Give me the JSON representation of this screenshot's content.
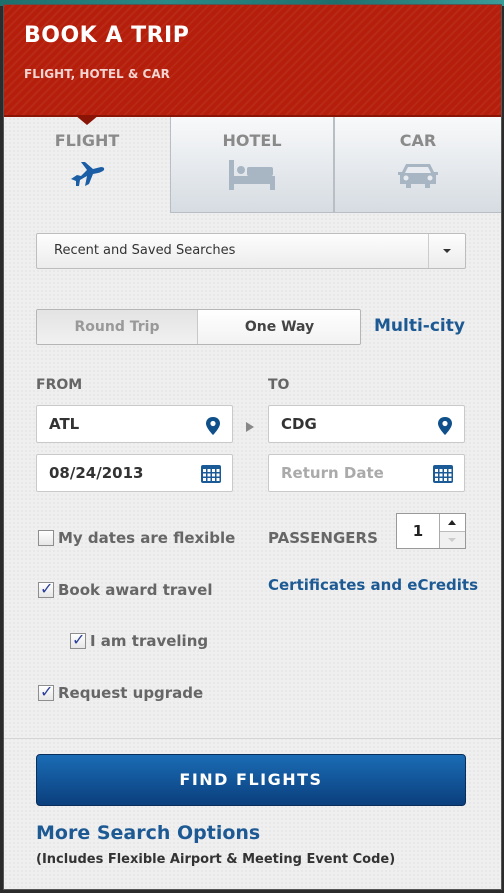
{
  "header": {
    "title": "BOOK A TRIP",
    "subtitle": "FLIGHT, HOTEL & CAR"
  },
  "tabs": [
    {
      "label": "FLIGHT",
      "icon": "airplane-icon",
      "active": true
    },
    {
      "label": "HOTEL",
      "icon": "bed-icon",
      "active": false
    },
    {
      "label": "CAR",
      "icon": "car-icon",
      "active": false
    }
  ],
  "recent_searches": {
    "label": "Recent and Saved Searches"
  },
  "trip_type": {
    "options": [
      "Round Trip",
      "One Way"
    ],
    "selected": "Round Trip",
    "multi_city_label": "Multi-city"
  },
  "from": {
    "label": "FROM",
    "airport": "ATL",
    "depart_date": "08/24/2013"
  },
  "to": {
    "label": "TO",
    "airport": "CDG",
    "return_date_placeholder": "Return Date"
  },
  "options": {
    "flexible_dates": {
      "label": "My dates are flexible",
      "checked": false
    },
    "award_travel": {
      "label": "Book award travel",
      "checked": true
    },
    "i_am_traveling": {
      "label": "I am traveling",
      "checked": true
    },
    "request_upgrade": {
      "label": "Request upgrade",
      "checked": true
    }
  },
  "passengers": {
    "label": "PASSENGERS",
    "value": "1"
  },
  "certificates_link": "Certificates and eCredits",
  "find_button": "FIND FLIGHTS",
  "more_options": {
    "link": "More Search Options",
    "note": "(Includes Flexible Airport & Meeting Event Code)"
  },
  "colors": {
    "header_red": "#b51e0b",
    "link_blue": "#1d5a94",
    "button_blue": "#0b3f7d"
  }
}
